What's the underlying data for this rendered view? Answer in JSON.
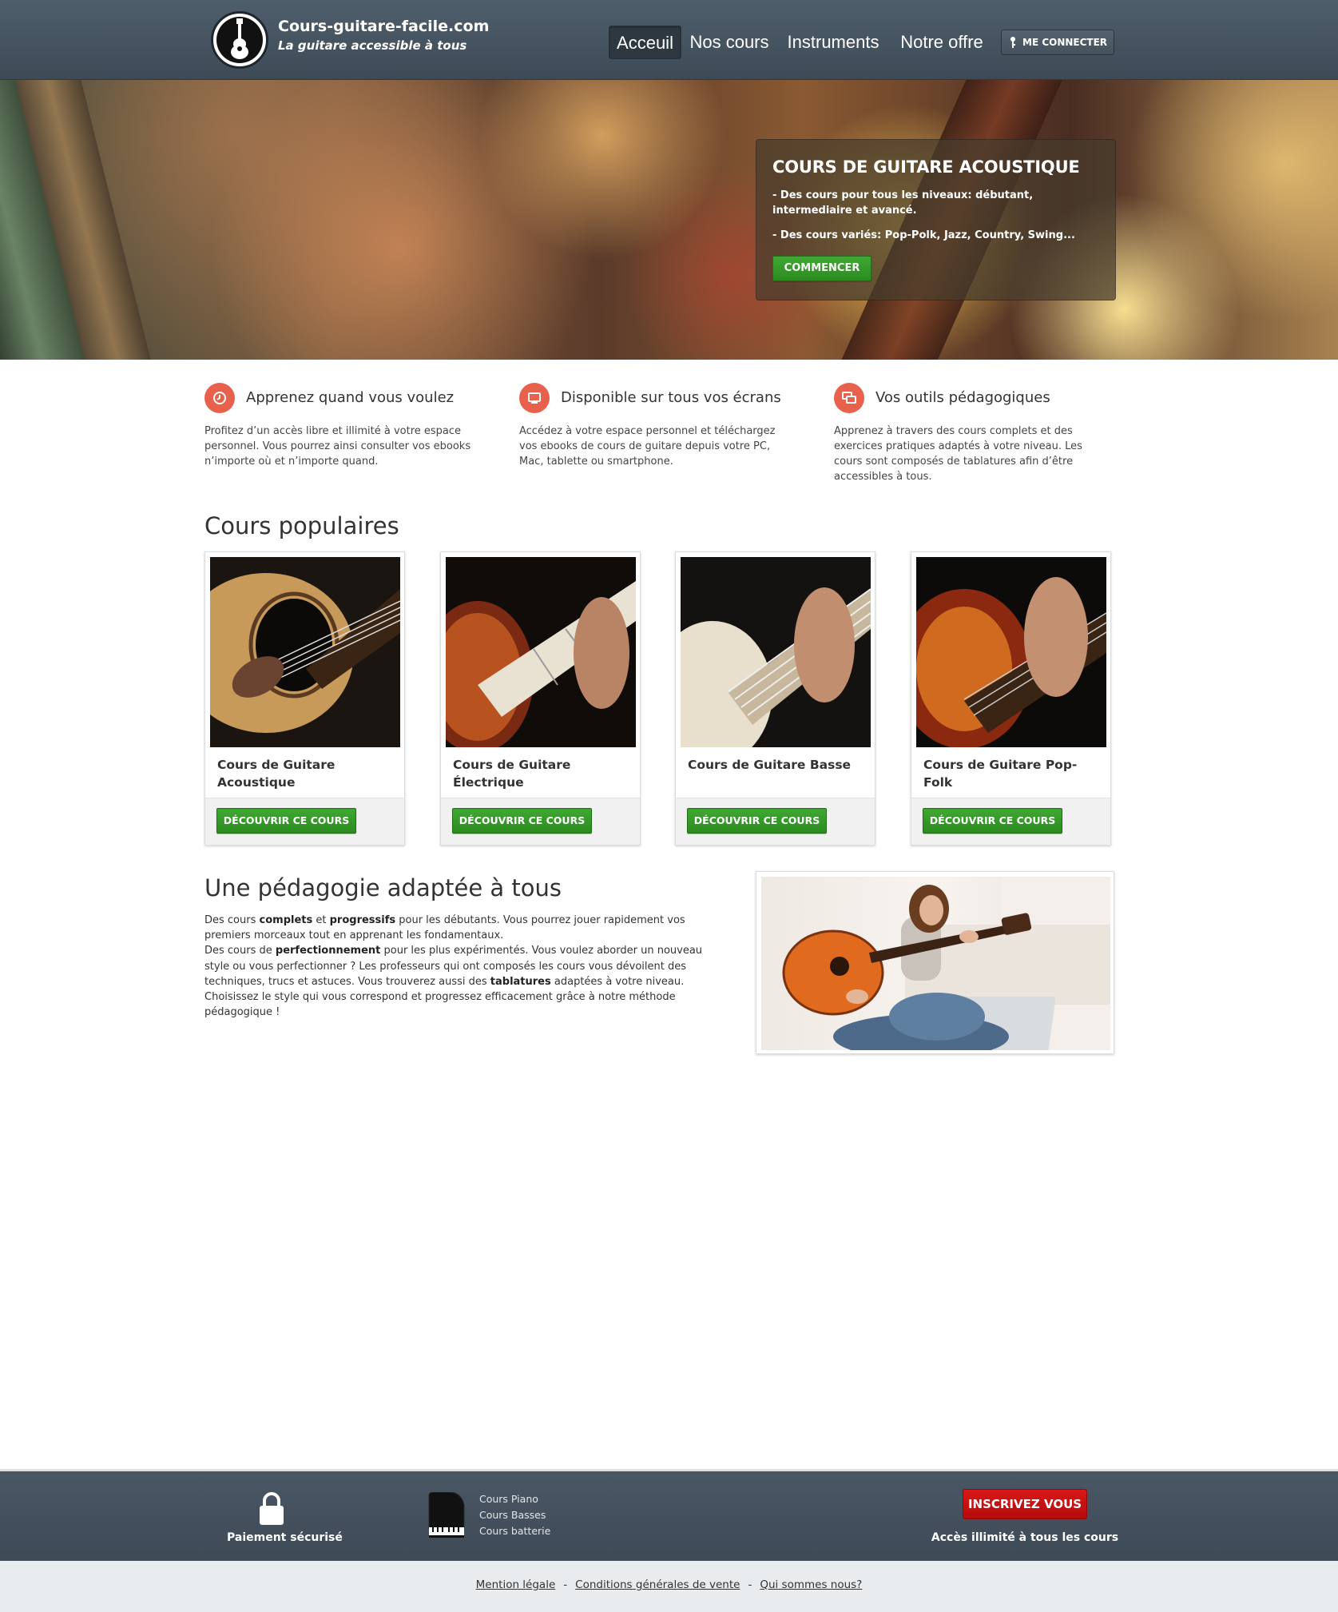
{
  "header": {
    "site_name": "Cours-guitare-facile.com",
    "tagline": "La guitare accessible à tous",
    "nav": [
      "Acceuil",
      "Nos cours",
      "Instruments",
      "Notre offre"
    ],
    "login": "ME CONNECTER"
  },
  "hero": {
    "title": "COURS DE GUITARE ACOUSTIQUE",
    "line1": "- Des cours pour tous les niveaux: débutant, intermediaire et avancé.",
    "line2": "- Des cours variés: Pop-Polk, Jazz, Country, Swing...",
    "button": "COMMENCER"
  },
  "features": [
    {
      "icon": "clock-icon",
      "title": "Apprenez quand vous voulez",
      "text": "Profitez d’un accès libre et illimité à votre espace personnel. Vous pourrez ainsi consulter vos ebooks n’importe où et n’importe quand."
    },
    {
      "icon": "screen-icon",
      "title": "Disponible sur tous vos écrans",
      "text": "Accédez à votre espace personnel et téléchargez vos ebooks de cours de guitare depuis votre PC, Mac, tablette ou smartphone."
    },
    {
      "icon": "chat-icon",
      "title": "Vos outils pédagogiques",
      "text": "Apprenez à travers des cours complets et des exercices pratiques adaptés à votre niveau. Les cours sont composés de tablatures afin d’être accessibles à tous."
    }
  ],
  "courses": {
    "title": "Cours populaires",
    "items": [
      {
        "title": "Cours de Guitare Acoustique",
        "button": "DÉCOUVRIR CE COURS"
      },
      {
        "title": "Cours de Guitare Électrique",
        "button": "DÉCOUVRIR CE COURS"
      },
      {
        "title": "Cours de Guitare Basse",
        "button": "DÉCOUVRIR CE COURS"
      },
      {
        "title": "Cours de Guitare Pop-Folk",
        "button": "DÉCOUVRIR CE COURS"
      }
    ]
  },
  "pedagogie": {
    "title": "Une pédagogie adaptée à tous",
    "p1_a": "Des cours ",
    "p1_b": "complets",
    "p1_c": " et ",
    "p1_d": "progressifs",
    "p1_e": " pour les débutants. Vous pourrez jouer rapidement vos premiers morceaux tout en apprenant les fondamentaux.",
    "p2_a": "Des cours de ",
    "p2_b": "perfectionnement",
    "p2_c": " pour les plus expérimentés. Vous voulez aborder un nouveau style ou vous perfectionner ? Les professeurs qui ont composés les cours vous dévoilent des techniques, trucs et astuces. Vous trouverez aussi des ",
    "p2_d": "tablatures",
    "p2_e": " adaptées à votre niveau.",
    "p3": "Choisissez le style qui vous correspond et progressez efficacement grâce à notre méthode pédagogique !"
  },
  "footer": {
    "secure": "Paiement sécurisé",
    "links": [
      "Cours Piano",
      "Cours Basses",
      "Cours batterie"
    ],
    "signup": "INSCRIVEZ VOUS",
    "access": "Accès illimité à tous les cours"
  },
  "bottom_links": [
    "Mention légale",
    "Conditions générales de vente",
    "Qui sommes nous?"
  ],
  "colors": {
    "accent_red": "#e8614c",
    "green": "#2c8b20",
    "header": "#45525d",
    "signup_red": "#c41010"
  }
}
